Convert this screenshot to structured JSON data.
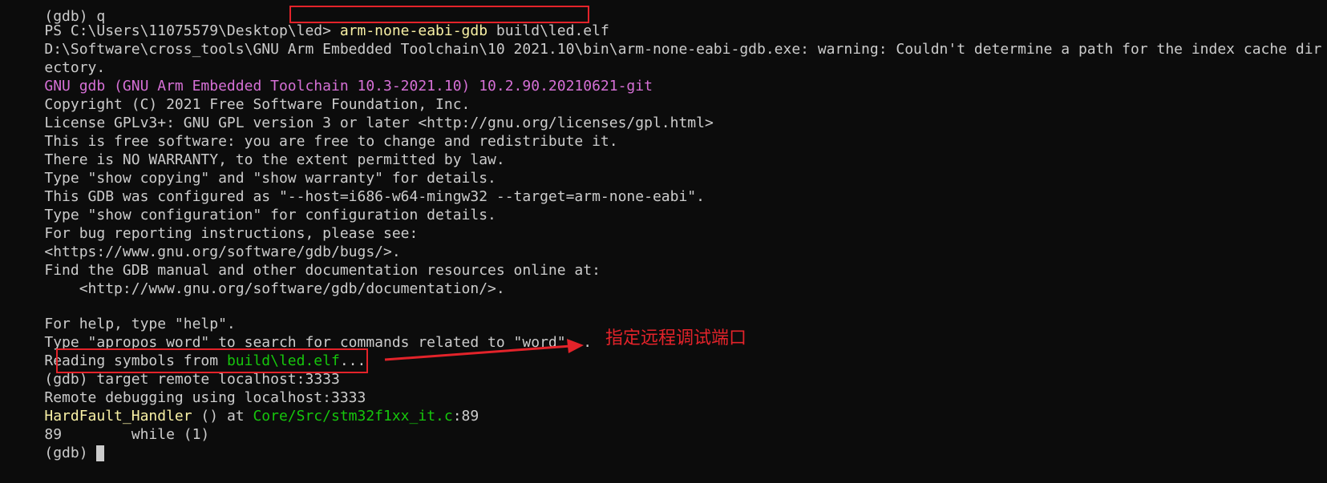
{
  "terminal": {
    "lines": {
      "prompt_partial": "(gdb) q",
      "ps_prompt": "PS C:\\Users\\11075579\\Desktop\\led>",
      "ps_command": "arm-none-eabi-gdb",
      "ps_command_arg": "build\\led.elf",
      "warning_1": "D:\\Software\\cross_tools\\GNU Arm Embedded Toolchain\\10 2021.10\\bin\\arm-none-eabi-gdb.exe: warning: Couldn't determine a path for the index cache dir",
      "warning_2": "ectory.",
      "gdb_version": "GNU gdb (GNU Arm Embedded Toolchain 10.3-2021.10) 10.2.90.20210621-git",
      "copyright": "Copyright (C) 2021 Free Software Foundation, Inc.",
      "license": "License GPLv3+: GNU GPL version 3 or later <http://gnu.org/licenses/gpl.html>",
      "free_sw": "This is free software: you are free to change and redistribute it.",
      "no_warranty": "There is NO WARRANTY, to the extent permitted by law.",
      "show_copying": "Type \"show copying\" and \"show warranty\" for details.",
      "configured": "This GDB was configured as \"--host=i686-w64-mingw32 --target=arm-none-eabi\".",
      "show_config": "Type \"show configuration\" for configuration details.",
      "bug_reporting": "For bug reporting instructions, please see:",
      "bug_url": "<https://www.gnu.org/software/gdb/bugs/>.",
      "find_manual": "Find the GDB manual and other documentation resources online at:",
      "manual_url": "    <http://www.gnu.org/software/gdb/documentation/>.",
      "blank": "",
      "help": "For help, type \"help\".",
      "apropos": "Type \"apropos word\" to search for commands related to \"word\"...",
      "reading_prefix": "Reading symbols from ",
      "reading_file": "build\\led.elf",
      "reading_suffix": "...",
      "gdb_prompt_1": "(gdb) ",
      "target_cmd": "target remote localhost:3333",
      "remote_debug": "Remote debugging using localhost:3333",
      "hardfault_func": "HardFault_Handler",
      "hardfault_mid": " () at ",
      "hardfault_file": "Core/Src/stm32f1xx_it.c",
      "hardfault_line": ":89",
      "source_line": "89        while (1)",
      "gdb_prompt_2": "(gdb) "
    }
  },
  "annotation": {
    "label": "指定远程调试端口"
  },
  "colors": {
    "background": "#0c0c0c",
    "text": "#cccccc",
    "highlight": "#e3232a",
    "yellow": "#f9f1a5",
    "magenta": "#d670d6",
    "green": "#16c60c"
  }
}
